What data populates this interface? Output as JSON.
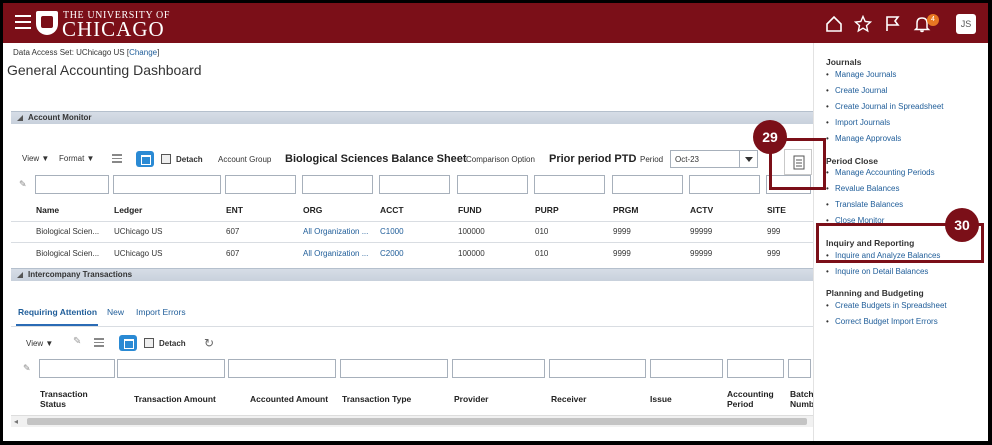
{
  "header": {
    "logo_line1": "THE UNIVERSITY OF",
    "logo_line2": "CHICAGO",
    "notification_count": "4",
    "user_initials": "JS"
  },
  "page": {
    "data_access_label": "Data Access Set: UChicago US [",
    "data_access_link": "Change",
    "data_access_end": "]",
    "title": "General Accounting Dashboard"
  },
  "account_monitor": {
    "section_title": "Account Monitor",
    "toolbar": {
      "view": "View ▼",
      "format": "Format ▼",
      "detach": "Detach",
      "account_group_label": "Account Group",
      "account_group_value": "Biological Sciences Balance Sheet",
      "comparison_label": "Comparison Option",
      "comparison_value": "Prior period PTD",
      "period_label": "Period",
      "period_value": "Oct-23"
    },
    "columns": [
      "Name",
      "Ledger",
      "ENT",
      "ORG",
      "ACCT",
      "FUND",
      "PURP",
      "PRGM",
      "ACTV",
      "SITE"
    ],
    "rows": [
      [
        "Biological Scien...",
        "UChicago US",
        "607",
        "All Organization ...",
        "C1000",
        "100000",
        "010",
        "9999",
        "99999",
        "999"
      ],
      [
        "Biological Scien...",
        "UChicago US",
        "607",
        "All Organization ...",
        "C2000",
        "100000",
        "010",
        "9999",
        "99999",
        "999"
      ]
    ]
  },
  "intercompany": {
    "section_title": "Intercompany Transactions",
    "tabs": [
      "Requiring Attention",
      "New",
      "Import Errors"
    ],
    "toolbar": {
      "view": "View ▼",
      "detach": "Detach"
    },
    "columns": [
      [
        "Transaction",
        "Status"
      ],
      [
        "Transaction Amount",
        ""
      ],
      [
        "Accounted Amount",
        ""
      ],
      [
        "Transaction Type",
        ""
      ],
      [
        "Provider",
        ""
      ],
      [
        "Receiver",
        ""
      ],
      [
        "Issue",
        ""
      ],
      [
        "Accounting",
        "Period"
      ],
      [
        "Batch",
        "Numb"
      ]
    ]
  },
  "right_panel": {
    "groups": [
      {
        "title": "Journals",
        "items": [
          "Manage Journals",
          "Create Journal",
          "Create Journal in Spreadsheet",
          "Import Journals",
          "Manage Approvals"
        ]
      },
      {
        "title": "Period Close",
        "items": [
          "Manage Accounting Periods",
          "Revalue Balances",
          "Translate Balances",
          "Close Monitor"
        ]
      },
      {
        "title": "Inquiry and Reporting",
        "items": [
          "Inquire and Analyze Balances",
          "Inquire on Detail Balances"
        ]
      },
      {
        "title": "Planning and Budgeting",
        "items": [
          "Create Budgets in Spreadsheet",
          "Correct Budget Import Errors"
        ]
      }
    ]
  },
  "annotations": {
    "callout_29": "29",
    "callout_30": "30"
  },
  "colors": {
    "brand": "#7b0f18",
    "link": "#1f5d99",
    "accent": "#2a8ad4",
    "badge": "#e87722"
  }
}
